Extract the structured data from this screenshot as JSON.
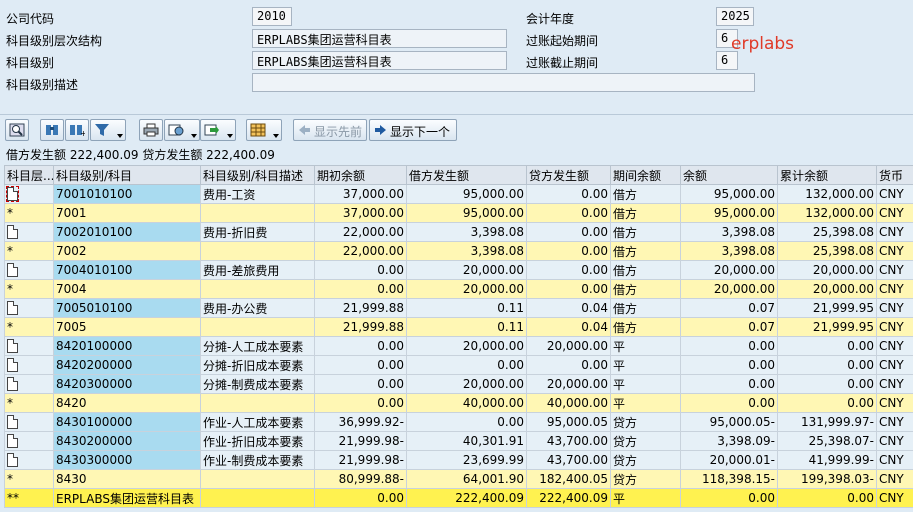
{
  "header": {
    "company_code_label": "公司代码",
    "company_code": "2010",
    "fiscal_year_label": "会计年度",
    "fiscal_year": "2025",
    "hierarchy_label": "科目级别层次结构",
    "hierarchy": "ERPLABS集团运营科目表",
    "period_from_label": "过账起始期间",
    "period_from": "6",
    "level_label": "科目级别",
    "level": "ERPLABS集团运营科目表",
    "period_to_label": "过账截止期间",
    "period_to": "6",
    "level_desc_label": "科目级别描述",
    "level_desc": "",
    "watermark": "erplabs"
  },
  "toolbar": {
    "icons": [
      "magnifier-detail-icon",
      "find-icon",
      "find-next-icon",
      "filter-icon",
      "print-icon",
      "export-icon",
      "send-icon",
      "layout-icon"
    ],
    "prev_label": "显示先前",
    "next_label": "显示下一个"
  },
  "summary": "借方发生额 222,400.09 贷方发生额 222,400.09",
  "columns": [
    "科目层...",
    "科目级别/科目",
    "科目级别/科目描述",
    "期初余额",
    "借方发生额",
    "贷方发生额",
    "期间余额",
    "余额",
    "累计余额",
    "货币"
  ],
  "rows": [
    {
      "type": "detail",
      "marker": "",
      "acct": "7001010100",
      "desc": "费用-工资",
      "opening": "37,000.00",
      "debit": "95,000.00",
      "credit": "0.00",
      "period_bal": "借方",
      "balance": "95,000.00",
      "cumulative": "132,000.00",
      "cur": "CNY"
    },
    {
      "type": "sub",
      "marker": "*",
      "acct": "7001",
      "desc": "",
      "opening": "37,000.00",
      "debit": "95,000.00",
      "credit": "0.00",
      "period_bal": "借方",
      "balance": "95,000.00",
      "cumulative": "132,000.00",
      "cur": "CNY"
    },
    {
      "type": "detail",
      "marker": "",
      "acct": "7002010100",
      "desc": "费用-折旧费",
      "opening": "22,000.00",
      "debit": "3,398.08",
      "credit": "0.00",
      "period_bal": "借方",
      "balance": "3,398.08",
      "cumulative": "25,398.08",
      "cur": "CNY"
    },
    {
      "type": "sub",
      "marker": "*",
      "acct": "7002",
      "desc": "",
      "opening": "22,000.00",
      "debit": "3,398.08",
      "credit": "0.00",
      "period_bal": "借方",
      "balance": "3,398.08",
      "cumulative": "25,398.08",
      "cur": "CNY"
    },
    {
      "type": "detail",
      "marker": "",
      "acct": "7004010100",
      "desc": "费用-差旅费用",
      "opening": "0.00",
      "debit": "20,000.00",
      "credit": "0.00",
      "period_bal": "借方",
      "balance": "20,000.00",
      "cumulative": "20,000.00",
      "cur": "CNY"
    },
    {
      "type": "sub",
      "marker": "*",
      "acct": "7004",
      "desc": "",
      "opening": "0.00",
      "debit": "20,000.00",
      "credit": "0.00",
      "period_bal": "借方",
      "balance": "20,000.00",
      "cumulative": "20,000.00",
      "cur": "CNY"
    },
    {
      "type": "detail",
      "marker": "",
      "acct": "7005010100",
      "desc": "费用-办公费",
      "opening": "21,999.88",
      "debit": "0.11",
      "credit": "0.04",
      "period_bal": "借方",
      "balance": "0.07",
      "cumulative": "21,999.95",
      "cur": "CNY"
    },
    {
      "type": "sub",
      "marker": "*",
      "acct": "7005",
      "desc": "",
      "opening": "21,999.88",
      "debit": "0.11",
      "credit": "0.04",
      "period_bal": "借方",
      "balance": "0.07",
      "cumulative": "21,999.95",
      "cur": "CNY"
    },
    {
      "type": "detail",
      "marker": "",
      "acct": "8420100000",
      "desc": "分摊-人工成本要素",
      "opening": "0.00",
      "debit": "20,000.00",
      "credit": "20,000.00",
      "period_bal": "平",
      "balance": "0.00",
      "cumulative": "0.00",
      "cur": "CNY"
    },
    {
      "type": "detail",
      "marker": "",
      "acct": "8420200000",
      "desc": "分摊-折旧成本要素",
      "opening": "0.00",
      "debit": "0.00",
      "credit": "0.00",
      "period_bal": "平",
      "balance": "0.00",
      "cumulative": "0.00",
      "cur": "CNY"
    },
    {
      "type": "detail",
      "marker": "",
      "acct": "8420300000",
      "desc": "分摊-制费成本要素",
      "opening": "0.00",
      "debit": "20,000.00",
      "credit": "20,000.00",
      "period_bal": "平",
      "balance": "0.00",
      "cumulative": "0.00",
      "cur": "CNY"
    },
    {
      "type": "sub",
      "marker": "*",
      "acct": "8420",
      "desc": "",
      "opening": "0.00",
      "debit": "40,000.00",
      "credit": "40,000.00",
      "period_bal": "平",
      "balance": "0.00",
      "cumulative": "0.00",
      "cur": "CNY"
    },
    {
      "type": "detail",
      "marker": "",
      "acct": "8430100000",
      "desc": "作业-人工成本要素",
      "opening": "36,999.92-",
      "debit": "0.00",
      "credit": "95,000.05",
      "period_bal": "贷方",
      "balance": "95,000.05-",
      "cumulative": "131,999.97-",
      "cur": "CNY"
    },
    {
      "type": "detail",
      "marker": "",
      "acct": "8430200000",
      "desc": "作业-折旧成本要素",
      "opening": "21,999.98-",
      "debit": "40,301.91",
      "credit": "43,700.00",
      "period_bal": "贷方",
      "balance": "3,398.09-",
      "cumulative": "25,398.07-",
      "cur": "CNY"
    },
    {
      "type": "detail",
      "marker": "",
      "acct": "8430300000",
      "desc": "作业-制费成本要素",
      "opening": "21,999.98-",
      "debit": "23,699.99",
      "credit": "43,700.00",
      "period_bal": "贷方",
      "balance": "20,000.01-",
      "cumulative": "41,999.99-",
      "cur": "CNY"
    },
    {
      "type": "sub",
      "marker": "*",
      "acct": "8430",
      "desc": "",
      "opening": "80,999.88-",
      "debit": "64,001.90",
      "credit": "182,400.05",
      "period_bal": "贷方",
      "balance": "118,398.15-",
      "cumulative": "199,398.03-",
      "cur": "CNY"
    },
    {
      "type": "total",
      "marker": "**",
      "acct": "ERPLABS集团运营科目表",
      "desc": "",
      "opening": "0.00",
      "debit": "222,400.09",
      "credit": "222,400.09",
      "period_bal": "平",
      "balance": "0.00",
      "cumulative": "0.00",
      "cur": "CNY"
    }
  ]
}
